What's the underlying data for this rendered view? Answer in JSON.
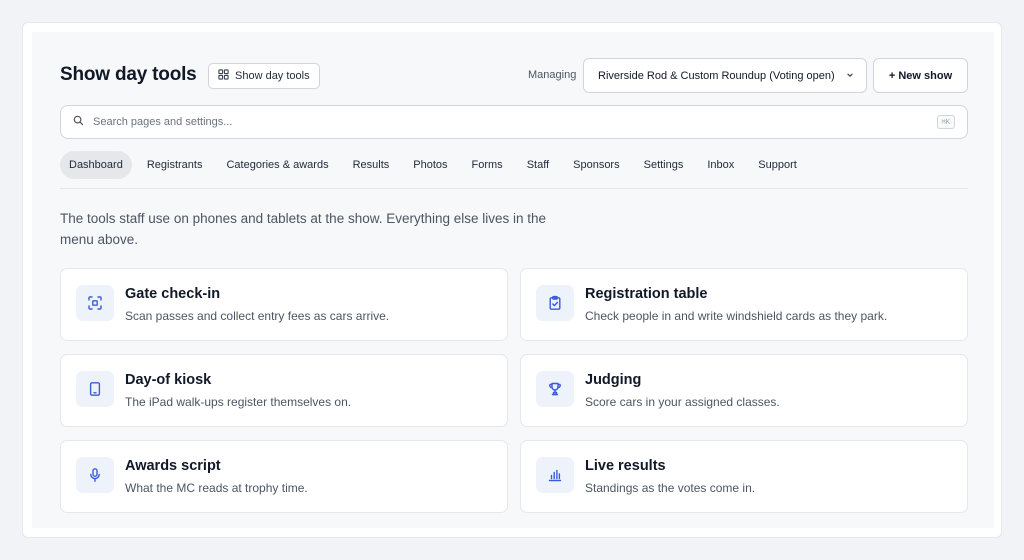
{
  "header": {
    "title": "Show day tools",
    "chip_label": "Show day tools",
    "managing_label": "Managing",
    "show_select_value": "Riverside Rod & Custom Roundup (Voting open)",
    "new_show_label": "+ New show"
  },
  "search": {
    "placeholder": "Search pages and settings...",
    "shortcut": "⌘K"
  },
  "nav": {
    "items": [
      {
        "label": "Dashboard",
        "active": true
      },
      {
        "label": "Registrants"
      },
      {
        "label": "Categories & awards"
      },
      {
        "label": "Results"
      },
      {
        "label": "Photos"
      },
      {
        "label": "Forms"
      },
      {
        "label": "Staff"
      },
      {
        "label": "Sponsors"
      },
      {
        "label": "Settings"
      },
      {
        "label": "Inbox"
      },
      {
        "label": "Support"
      }
    ]
  },
  "intro": "The tools staff use on phones and tablets at the show. Everything else lives in the menu above.",
  "cards": [
    {
      "title": "Gate check-in",
      "desc": "Scan passes and collect entry fees as cars arrive.",
      "icon": "scan-icon"
    },
    {
      "title": "Registration table",
      "desc": "Check people in and write windshield cards as they park.",
      "icon": "clipboard-check-icon"
    },
    {
      "title": "Day-of kiosk",
      "desc": "The iPad walk-ups register themselves on.",
      "icon": "tablet-icon"
    },
    {
      "title": "Judging",
      "desc": "Score cars in your assigned classes.",
      "icon": "trophy-icon"
    },
    {
      "title": "Awards script",
      "desc": "What the MC reads at trophy time.",
      "icon": "microphone-icon"
    },
    {
      "title": "Live results",
      "desc": "Standings as the votes come in.",
      "icon": "bar-chart-icon"
    }
  ],
  "colors": {
    "accent_icon": "#3b5bdb",
    "icon_bg": "#eef2fb",
    "page_bg": "#f7f8fa"
  }
}
